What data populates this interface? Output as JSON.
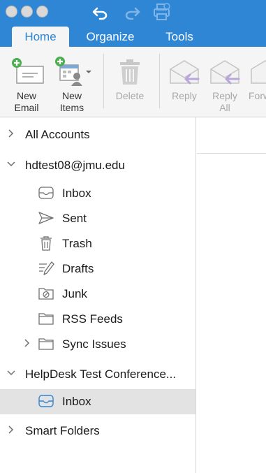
{
  "window": {
    "traffic_lights": [
      "close",
      "minimize",
      "zoom"
    ],
    "toolbar_icons": [
      "undo-icon",
      "redo-icon",
      "print-icon"
    ]
  },
  "tabs": [
    {
      "label": "Home",
      "active": true
    },
    {
      "label": "Organize",
      "active": false
    },
    {
      "label": "Tools",
      "active": false
    }
  ],
  "ribbon": {
    "new_email": {
      "line1": "New",
      "line2": "Email"
    },
    "new_items": {
      "line1": "New",
      "line2": "Items"
    },
    "delete": {
      "label": "Delete"
    },
    "reply": {
      "label": "Reply"
    },
    "reply_all": {
      "line1": "Reply",
      "line2": "All"
    },
    "forward": {
      "label": "Forw"
    }
  },
  "sidebar": {
    "all_accounts": "All Accounts",
    "account1": {
      "name": "hdtest08@jmu.edu",
      "folders": [
        {
          "label": "Inbox",
          "icon": "inbox-icon"
        },
        {
          "label": "Sent",
          "icon": "sent-icon"
        },
        {
          "label": "Trash",
          "icon": "trash-icon"
        },
        {
          "label": "Drafts",
          "icon": "drafts-icon"
        },
        {
          "label": "Junk",
          "icon": "junk-icon"
        },
        {
          "label": "RSS Feeds",
          "icon": "folder-icon"
        },
        {
          "label": "Sync Issues",
          "icon": "folder-icon"
        }
      ]
    },
    "account2": {
      "name": "HelpDesk Test Conference...",
      "folders": [
        {
          "label": "Inbox",
          "icon": "inbox-icon",
          "selected": true
        }
      ]
    },
    "smart_folders": "Smart Folders"
  },
  "colors": {
    "accent": "#2e86d4",
    "ribbon_bg": "#f5f5f5",
    "selection": "#e3e3e3"
  }
}
